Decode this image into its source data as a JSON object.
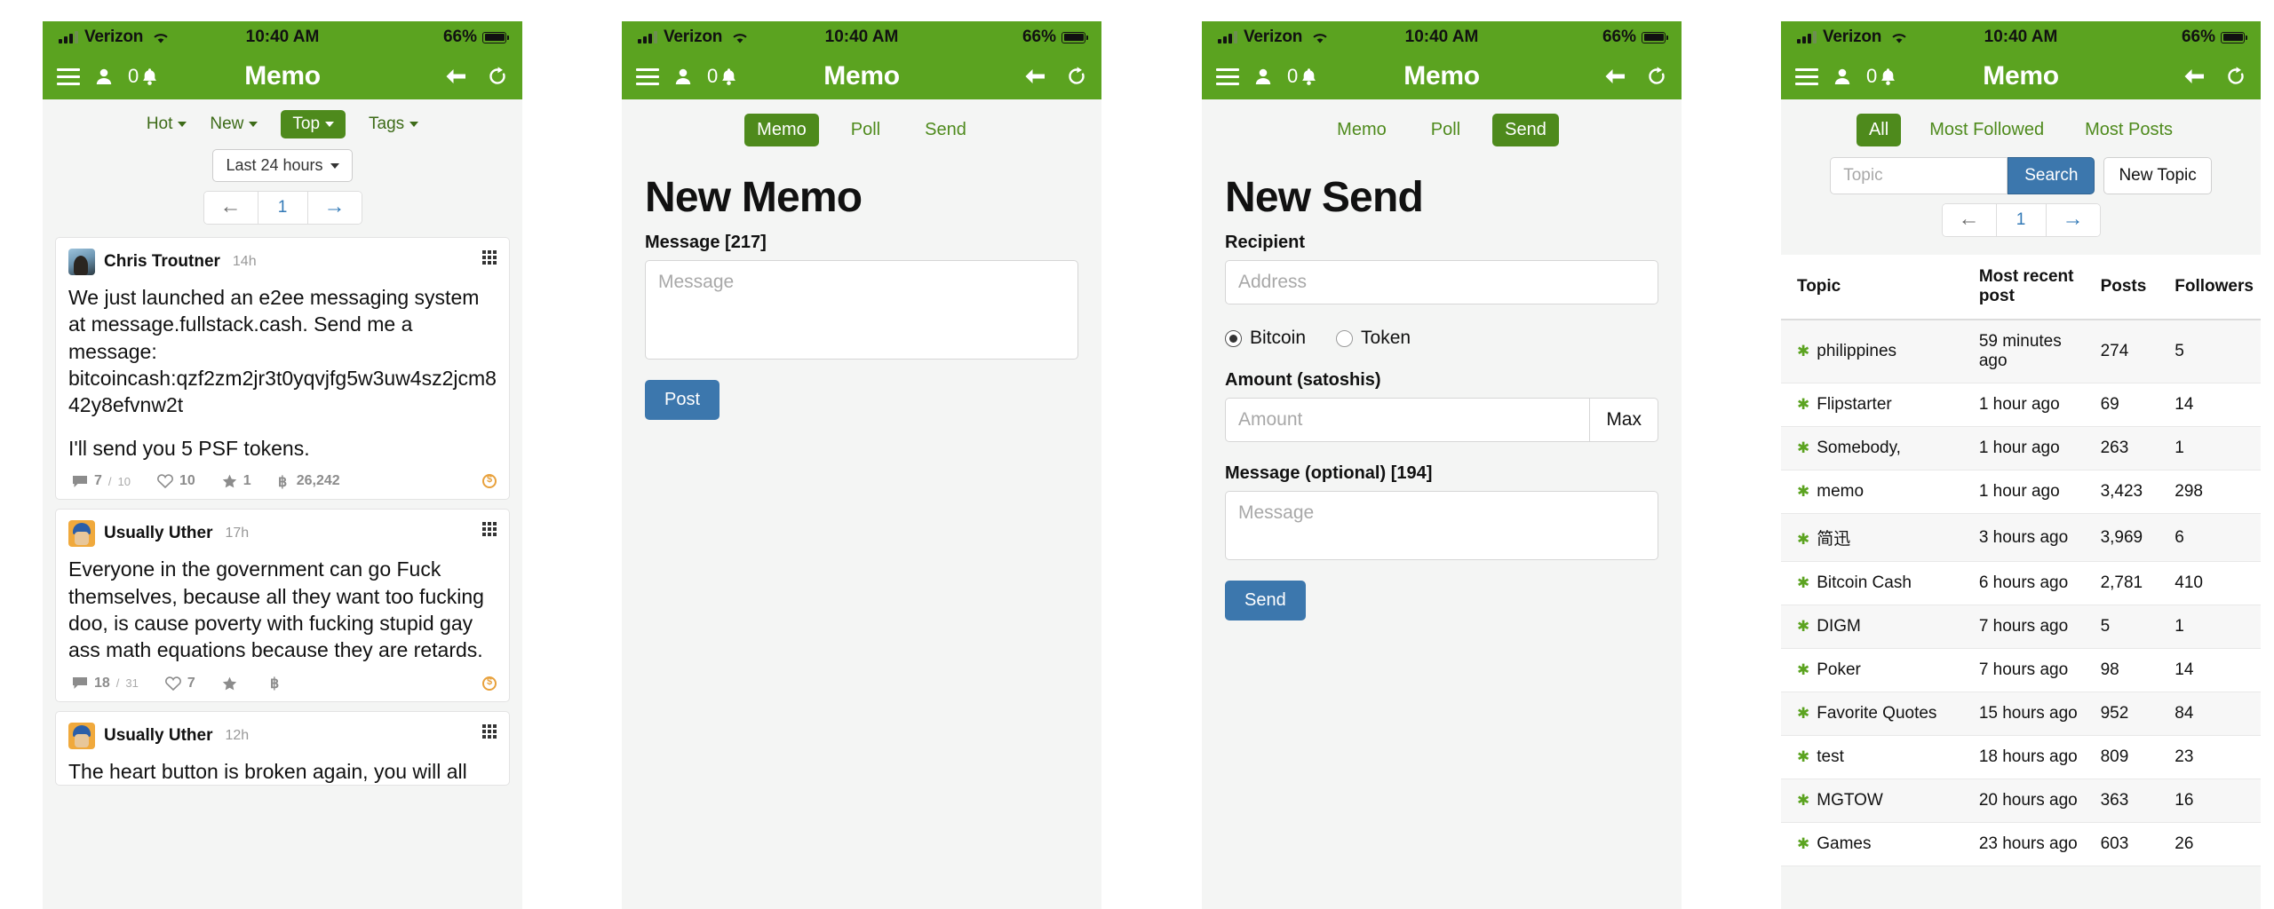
{
  "status_bar": {
    "carrier": "Verizon",
    "time": "10:40 AM",
    "battery": "66%"
  },
  "nav": {
    "title": "Memo",
    "notif_count": "0"
  },
  "panel1": {
    "sort_tabs": [
      {
        "label": "Hot",
        "active": false,
        "caret": true
      },
      {
        "label": "New",
        "active": false,
        "caret": true
      },
      {
        "label": "Top",
        "active": true,
        "caret": true
      },
      {
        "label": "Tags",
        "active": false,
        "caret": true
      }
    ],
    "time_filter": "Last 24 hours",
    "pager": {
      "prev": "←",
      "page": "1",
      "next": "→"
    },
    "posts": [
      {
        "author": "Chris Troutner",
        "time": "14h",
        "avatar": "av1",
        "paragraphs": [
          "We just launched an e2ee messaging system at message.fullstack.cash. Send me a message: bitcoincash:qzf2zm2jr3t0yqvjfg5w3uw4sz2jcm842y8efvnw2t",
          "I'll send you 5 PSF tokens."
        ],
        "replies": "7",
        "replies_total": "10",
        "likes": "10",
        "stars": "1",
        "tips": "26,242",
        "has_tip_badge": true
      },
      {
        "author": "Usually Uther",
        "time": "17h",
        "avatar": "av2",
        "paragraphs": [
          "Everyone in the government can go Fuck themselves, because all they want too fucking doo, is cause poverty with fucking stupid gay ass math equations because they are retards."
        ],
        "replies": "18",
        "replies_total": "31",
        "likes": "7",
        "stars": "",
        "tips": "",
        "has_tip_badge": true
      },
      {
        "author": "Usually Uther",
        "time": "12h",
        "avatar": "av3",
        "paragraphs": [
          "The heart button is broken again, you will all"
        ],
        "replies": "",
        "replies_total": "",
        "likes": "",
        "stars": "",
        "tips": "",
        "has_tip_badge": false
      }
    ]
  },
  "panel2": {
    "tabs": [
      {
        "label": "Memo",
        "active": true
      },
      {
        "label": "Poll",
        "active": false
      },
      {
        "label": "Send",
        "active": false
      }
    ],
    "title": "New Memo",
    "message_label": "Message [217]",
    "message_placeholder": "Message",
    "post_button": "Post"
  },
  "panel3": {
    "tabs": [
      {
        "label": "Memo",
        "active": false
      },
      {
        "label": "Poll",
        "active": false
      },
      {
        "label": "Send",
        "active": true
      }
    ],
    "title": "New Send",
    "recipient_label": "Recipient",
    "recipient_placeholder": "Address",
    "radios": [
      {
        "label": "Bitcoin",
        "selected": true
      },
      {
        "label": "Token",
        "selected": false
      }
    ],
    "amount_label": "Amount (satoshis)",
    "amount_placeholder": "Amount",
    "max_button": "Max",
    "message_label": "Message (optional) [194]",
    "message_placeholder": "Message",
    "send_button": "Send"
  },
  "panel4": {
    "filter_tabs": [
      {
        "label": "All",
        "active": true
      },
      {
        "label": "Most Followed",
        "active": false
      },
      {
        "label": "Most Posts",
        "active": false
      }
    ],
    "search_placeholder": "Topic",
    "search_button": "Search",
    "new_topic_button": "New Topic",
    "pager": {
      "prev": "←",
      "page": "1",
      "next": "→"
    },
    "table": {
      "columns": [
        "Topic",
        "Most recent post",
        "Posts",
        "Followers"
      ],
      "rows": [
        {
          "topic": "philippines",
          "recent": "59 minutes ago",
          "posts": "274",
          "followers": "5"
        },
        {
          "topic": "Flipstarter",
          "recent": "1 hour ago",
          "posts": "69",
          "followers": "14"
        },
        {
          "topic": "Somebody,",
          "recent": "1 hour ago",
          "posts": "263",
          "followers": "1"
        },
        {
          "topic": "memo",
          "recent": "1 hour ago",
          "posts": "3,423",
          "followers": "298"
        },
        {
          "topic": "简迅",
          "recent": "3 hours ago",
          "posts": "3,969",
          "followers": "6"
        },
        {
          "topic": "Bitcoin Cash",
          "recent": "6 hours ago",
          "posts": "2,781",
          "followers": "410"
        },
        {
          "topic": "DIGM",
          "recent": "7 hours ago",
          "posts": "5",
          "followers": "1"
        },
        {
          "topic": "Poker",
          "recent": "7 hours ago",
          "posts": "98",
          "followers": "14"
        },
        {
          "topic": "Favorite Quotes",
          "recent": "15 hours ago",
          "posts": "952",
          "followers": "84"
        },
        {
          "topic": "test",
          "recent": "18 hours ago",
          "posts": "809",
          "followers": "23"
        },
        {
          "topic": "MGTOW",
          "recent": "20 hours ago",
          "posts": "363",
          "followers": "16"
        },
        {
          "topic": "Games",
          "recent": "23 hours ago",
          "posts": "603",
          "followers": "26"
        }
      ]
    }
  },
  "colors": {
    "brand_green": "#5ba320",
    "active_green": "#4e8a1c",
    "link_green": "#3d6b18",
    "blue": "#3c77ad",
    "link_blue": "#337ab7"
  }
}
